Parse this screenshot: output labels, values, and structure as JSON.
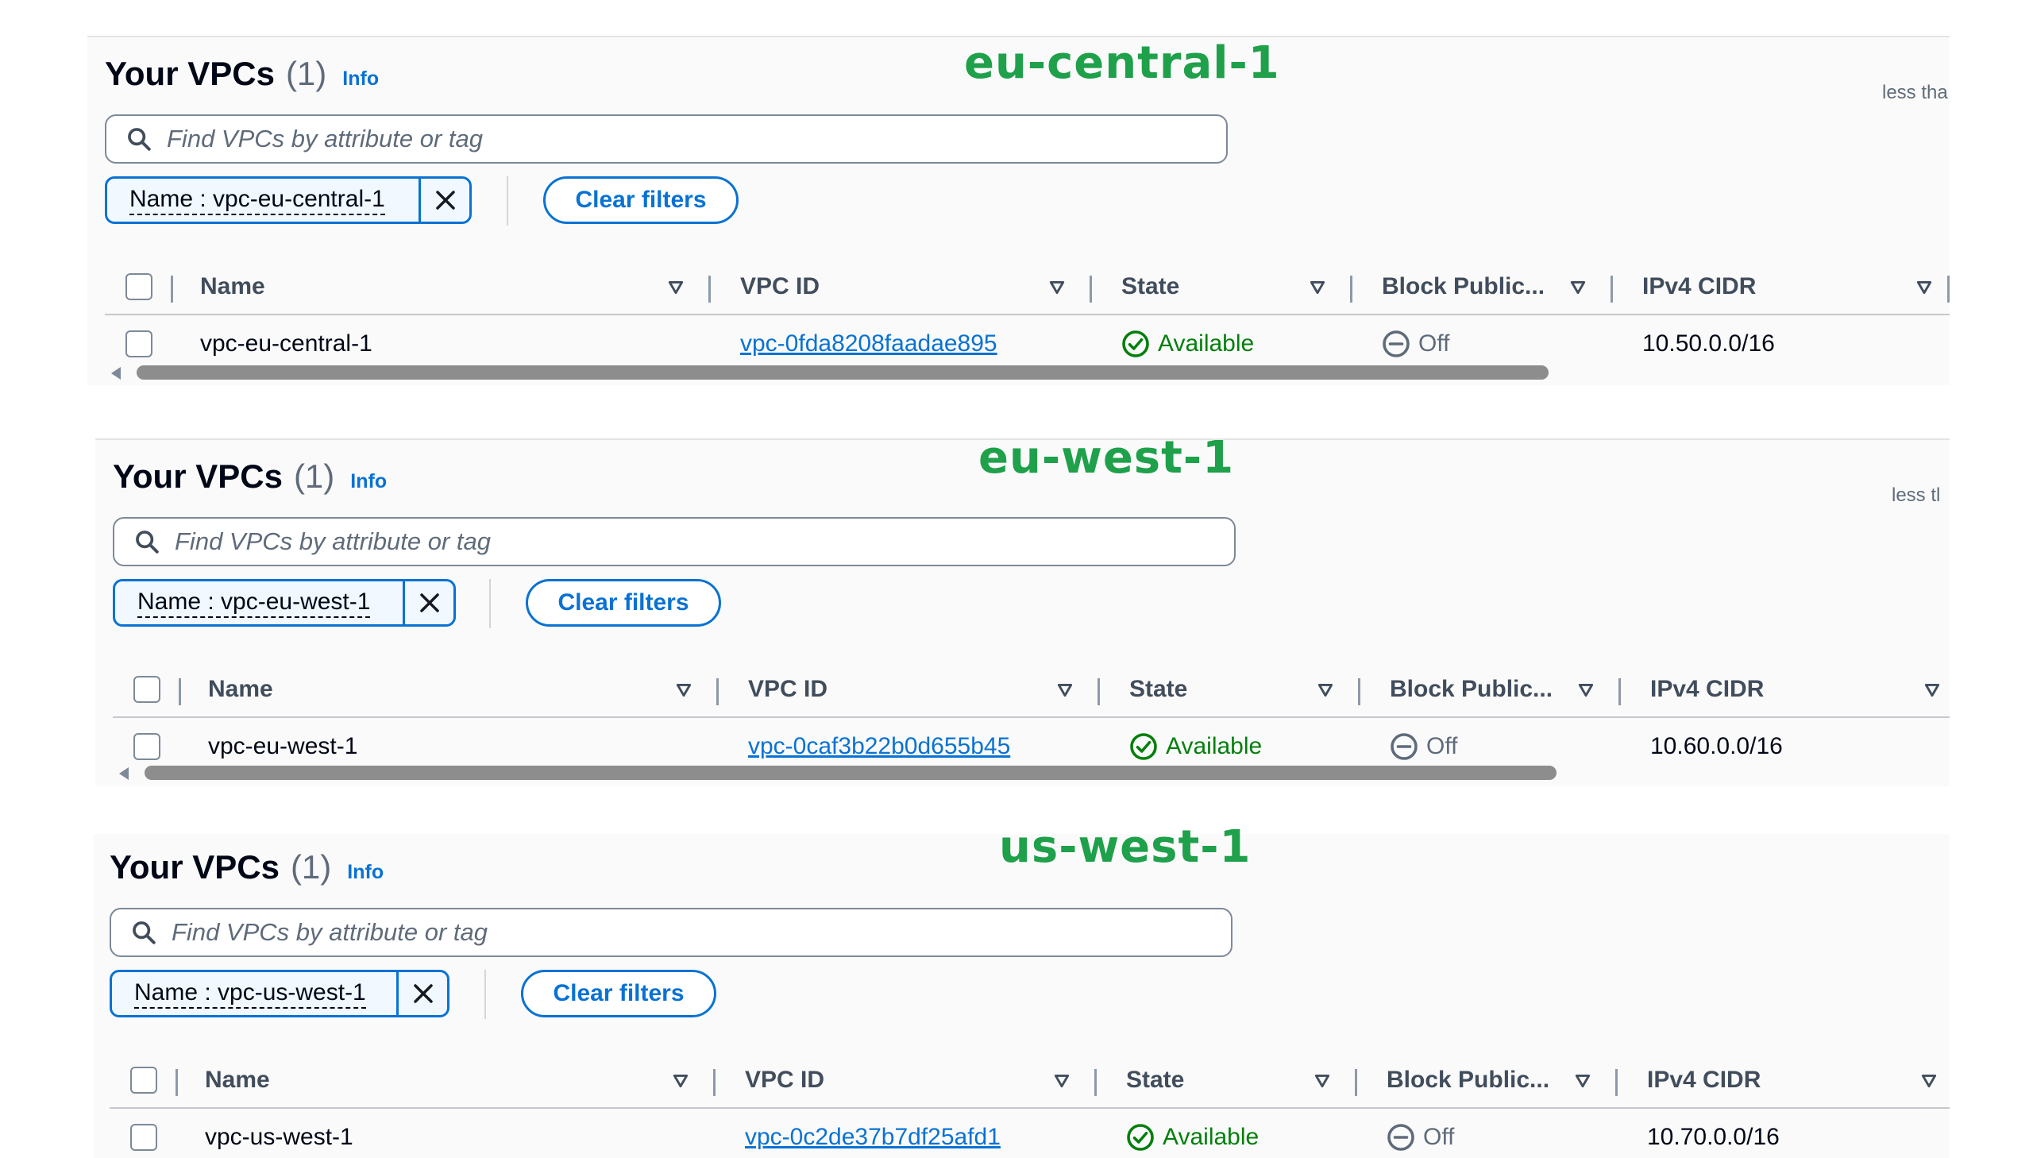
{
  "panels": [
    {
      "region": "eu-central-1",
      "title": "Your VPCs",
      "count": "(1)",
      "info": "Info",
      "less_text": "less tha",
      "search_placeholder": "Find VPCs by attribute or tag",
      "filter_token": "Name : vpc-eu-central-1",
      "clear_filters": "Clear filters",
      "columns": [
        "Name",
        "VPC ID",
        "State",
        "Block Public...",
        "IPv4 CIDR"
      ],
      "row": {
        "name": "vpc-eu-central-1",
        "vpc_id": "vpc-0fda8208faadae895",
        "state": "Available",
        "block_public": "Off",
        "ipv4_cidr": "10.50.0.0/16"
      }
    },
    {
      "region": "eu-west-1",
      "title": "Your VPCs",
      "count": "(1)",
      "info": "Info",
      "less_text": "less tl",
      "search_placeholder": "Find VPCs by attribute or tag",
      "filter_token": "Name : vpc-eu-west-1",
      "clear_filters": "Clear filters",
      "columns": [
        "Name",
        "VPC ID",
        "State",
        "Block Public...",
        "IPv4 CIDR"
      ],
      "row": {
        "name": "vpc-eu-west-1",
        "vpc_id": "vpc-0caf3b22b0d655b45",
        "state": "Available",
        "block_public": "Off",
        "ipv4_cidr": "10.60.0.0/16"
      }
    },
    {
      "region": "us-west-1",
      "title": "Your VPCs",
      "count": "(1)",
      "info": "Info",
      "less_text": "",
      "search_placeholder": "Find VPCs by attribute or tag",
      "filter_token": "Name : vpc-us-west-1",
      "clear_filters": "Clear filters",
      "columns": [
        "Name",
        "VPC ID",
        "State",
        "Block Public...",
        "IPv4 CIDR"
      ],
      "row": {
        "name": "vpc-us-west-1",
        "vpc_id": "vpc-0c2de37b7df25afd1",
        "state": "Available",
        "block_public": "Off",
        "ipv4_cidr": "10.70.0.0/16"
      }
    }
  ],
  "icons": {
    "search": "search-icon",
    "remove": "close-icon",
    "sort": "sort-down-icon",
    "state_available": "check-circle-icon",
    "state_off": "minus-circle-icon",
    "scroll_left": "caret-left-icon"
  },
  "colors": {
    "region_label": "#1fa04a",
    "link": "#0972d3",
    "available": "#037f0c",
    "muted": "#5f6b7a"
  }
}
